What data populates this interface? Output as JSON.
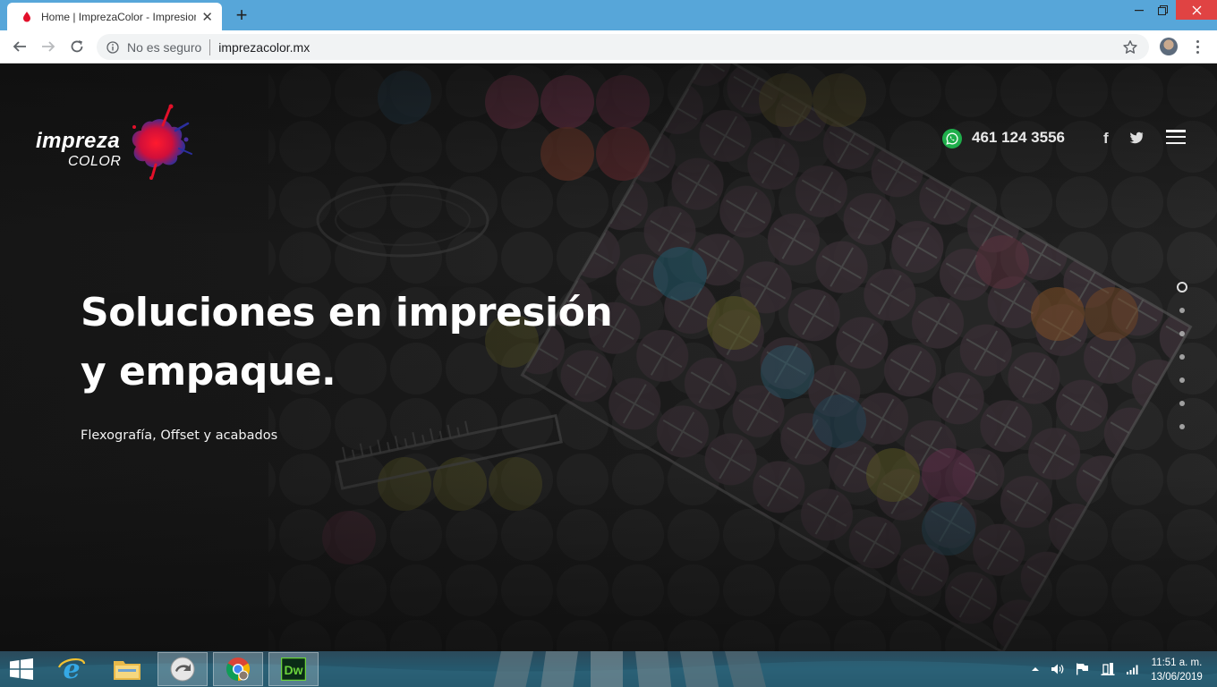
{
  "browser": {
    "tab_title": "Home | ImprezaColor - Impresion",
    "new_tab_symbol": "+",
    "close_symbol": "✕",
    "security_label": "No es seguro",
    "url": "imprezacolor.mx"
  },
  "site": {
    "logo_line1": "impreza",
    "logo_line2": "COLOR",
    "phone": "461 124 3556",
    "facebook_glyph": "f",
    "headline_line1": "Soluciones en impresión",
    "headline_line2": "y empaque.",
    "subheadline": "Flexografía, Offset y acabados",
    "slider_dots": 7,
    "slider_active_index": 0
  },
  "taskbar": {
    "apps": [
      "internet-explorer",
      "file-explorer",
      "ftp-client",
      "google-chrome",
      "dreamweaver"
    ],
    "dreamweaver_label": "Dw",
    "clock_time": "11:51 a. m.",
    "clock_date": "13/06/2019"
  },
  "colors": {
    "tabbar": "#57a6d9",
    "whatsapp": "#1fae4b",
    "logo_splash_red": "#e2102a",
    "logo_splash_blue": "#2b2f9e",
    "close_button": "#e04343"
  }
}
